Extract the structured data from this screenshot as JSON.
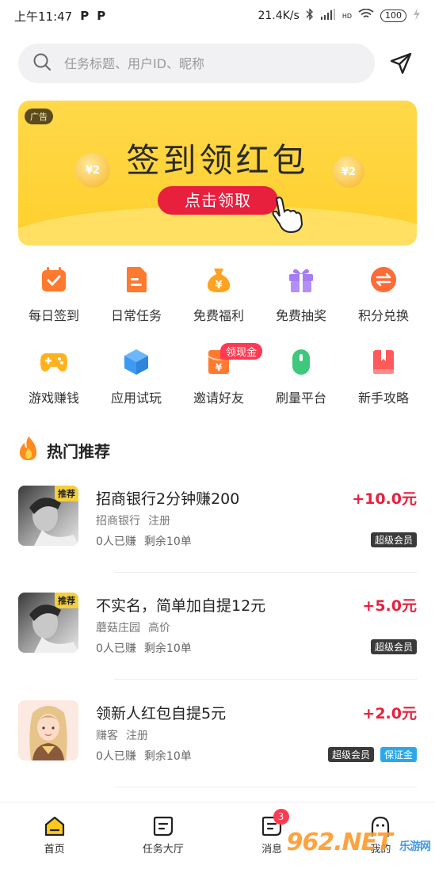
{
  "status_bar": {
    "time": "上午11:47",
    "speed": "21.4K/s",
    "network": "HD",
    "battery": "100"
  },
  "search": {
    "placeholder": "任务标题、用户ID、昵称"
  },
  "banner": {
    "ad_label": "广告",
    "title": "签到领红包",
    "button": "点击领取",
    "coin_label": "¥2"
  },
  "grid": {
    "items": [
      {
        "label": "每日签到",
        "icon": "calendar-check-icon",
        "color": "#ff7a2e"
      },
      {
        "label": "日常任务",
        "icon": "document-icon",
        "color": "#ff7a2e"
      },
      {
        "label": "免费福利",
        "icon": "money-bag-icon",
        "color": "#ffa21f"
      },
      {
        "label": "免费抽奖",
        "icon": "gift-icon",
        "color": "#a77cf3"
      },
      {
        "label": "积分兑换",
        "icon": "exchange-icon",
        "color": "#ff6a36"
      },
      {
        "label": "游戏赚钱",
        "icon": "gamepad-icon",
        "color": "#ffb21e"
      },
      {
        "label": "应用试玩",
        "icon": "cube-icon",
        "color": "#3d9af0"
      },
      {
        "label": "邀请好友",
        "icon": "red-envelope-icon",
        "color": "#ff7a2e",
        "badge": "领现金"
      },
      {
        "label": "刷量平台",
        "icon": "mouse-icon",
        "color": "#3ec87c"
      },
      {
        "label": "新手攻略",
        "icon": "book-icon",
        "color": "#ff5a5a"
      }
    ]
  },
  "section": {
    "title": "热门推荐"
  },
  "tasks": [
    {
      "title": "招商银行2分钟赚200",
      "price": "+10.0元",
      "publisher": "招商银行",
      "type": "注册",
      "earned": "0人已赚",
      "remaining": "剩余10单",
      "thumb_tag": "推荐",
      "tags": [
        "超级会员"
      ]
    },
    {
      "title": "不实名，简单加自提12元",
      "price": "+5.0元",
      "publisher": "蘑菇庄园",
      "type": "高价",
      "earned": "0人已赚",
      "remaining": "剩余10单",
      "thumb_tag": "推荐",
      "tags": [
        "超级会员"
      ]
    },
    {
      "title": "领新人红包自提5元",
      "price": "+2.0元",
      "publisher": "赚客",
      "type": "注册",
      "earned": "0人已赚",
      "remaining": "剩余10单",
      "thumb_tag": "",
      "tags": [
        "超级会员",
        "保证金"
      ]
    }
  ],
  "bottom_nav": {
    "items": [
      {
        "label": "首页",
        "icon": "home-icon",
        "active": true
      },
      {
        "label": "任务大厅",
        "icon": "task-hall-icon"
      },
      {
        "label": "消息",
        "icon": "message-icon",
        "badge": "3"
      },
      {
        "label": "我的",
        "icon": "profile-icon"
      }
    ]
  },
  "watermark": {
    "text": "962.NET",
    "sub": "乐游网"
  },
  "colors": {
    "accent_red": "#e8203e",
    "banner_yellow": "#ffd94a",
    "vip_tag": "#3a3a3a",
    "guarantee_tag": "#2aa9ea"
  }
}
